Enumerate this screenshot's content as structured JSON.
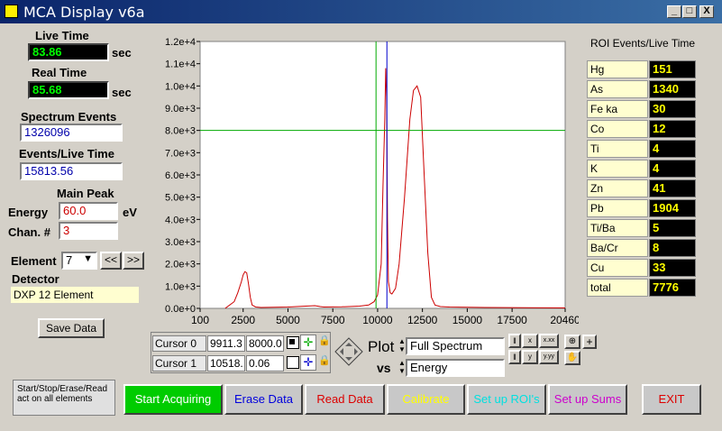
{
  "window": {
    "title": "MCA Display v6a",
    "min": "_",
    "max": "□",
    "close": "X"
  },
  "left": {
    "live_time_label": "Live Time",
    "live_time": "83.86",
    "sec1": "sec",
    "real_time_label": "Real Time",
    "real_time": "85.68",
    "sec2": "sec",
    "spectrum_events_label": "Spectrum Events",
    "spectrum_events": "1326096",
    "events_live_label": "Events/Live Time",
    "events_live": "15813.56",
    "main_peak_label": "Main Peak",
    "energy_label": "Energy",
    "energy": "60.0",
    "energy_unit": "eV",
    "chan_label": "Chan. #",
    "chan": "3",
    "element_label": "Element",
    "element_value": "7",
    "prev": "<<",
    "next": ">>",
    "detector_label": "Detector",
    "detector": "DXP 12 Element",
    "save": "Save Data",
    "note": "Start/Stop/Erase/Read act on all elements"
  },
  "roi": {
    "title": "ROI Events/Live Time",
    "rows": [
      {
        "name": "Hg",
        "value": "151"
      },
      {
        "name": "As",
        "value": "1340"
      },
      {
        "name": "Fe ka",
        "value": "30"
      },
      {
        "name": "Co",
        "value": "12"
      },
      {
        "name": "Ti",
        "value": "4"
      },
      {
        "name": "K",
        "value": "4"
      },
      {
        "name": "Zn",
        "value": "41"
      },
      {
        "name": "Pb",
        "value": "1904"
      },
      {
        "name": "Ti/Ba",
        "value": "5"
      },
      {
        "name": "Ba/Cr",
        "value": "8"
      },
      {
        "name": "Cu",
        "value": "33"
      },
      {
        "name": "total",
        "value": "7776"
      }
    ]
  },
  "cursors": [
    {
      "name": "Cursor 0",
      "x": "9911.3",
      "y": "8000.0"
    },
    {
      "name": "Cursor 1",
      "x": "10518.",
      "y": "0.06"
    }
  ],
  "plot_ctrl": {
    "plot": "Plot",
    "vs": "vs",
    "plot_value": "Full Spectrum",
    "vs_value": "Energy"
  },
  "buttons": {
    "start": "Start Acquiring",
    "erase": "Erase Data",
    "read": "Read Data",
    "calibrate": "Calibrate",
    "rois": "Set up ROI's",
    "sums": "Set up Sums",
    "exit": "EXIT"
  },
  "colors": {
    "trace": "#cc0000",
    "cursor0": "#00aa00",
    "cursor1": "#0000cc",
    "indicator": "#00ff00"
  },
  "chart_data": {
    "type": "line",
    "xlim": [
      100,
      20460
    ],
    "ylim": [
      0,
      12000
    ],
    "x_ticks": [
      "100",
      "2500",
      "5000",
      "7500",
      "10000",
      "12500",
      "15000",
      "17500",
      "20460"
    ],
    "y_ticks": [
      "0.0e+0",
      "1.0e+3",
      "2.0e+3",
      "3.0e+3",
      "4.0e+3",
      "5.0e+3",
      "6.0e+3",
      "7.0e+3",
      "8.0e+3",
      "9.0e+3",
      "1.0e+4",
      "1.1e+4",
      "1.2e+4"
    ],
    "series": [
      {
        "x": [
          1500,
          2000,
          2200,
          2400,
          2500,
          2600,
          2700,
          2800,
          2900,
          3000,
          3200,
          3500,
          5000,
          6500,
          6800,
          7000,
          8000,
          9000,
          9500,
          9800,
          10000,
          10200,
          10300,
          10400,
          10450,
          10500,
          10550,
          10600,
          10700,
          10800,
          11000,
          11200,
          11500,
          11800,
          12000,
          12200,
          12400,
          12600,
          12800,
          13000,
          13200,
          13500,
          14000,
          16000,
          20460
        ],
        "y": [
          0,
          300,
          700,
          1200,
          1500,
          1650,
          1600,
          1100,
          500,
          150,
          60,
          40,
          60,
          120,
          80,
          60,
          70,
          100,
          150,
          300,
          600,
          2000,
          5500,
          8500,
          10800,
          9500,
          4000,
          1200,
          700,
          650,
          900,
          2000,
          5000,
          8500,
          9800,
          10000,
          9500,
          6000,
          2500,
          500,
          150,
          80,
          60,
          40,
          20
        ]
      }
    ],
    "cursor_x": [
      9911.3,
      10518
    ],
    "cursor_y": [
      8000,
      0.06
    ]
  }
}
